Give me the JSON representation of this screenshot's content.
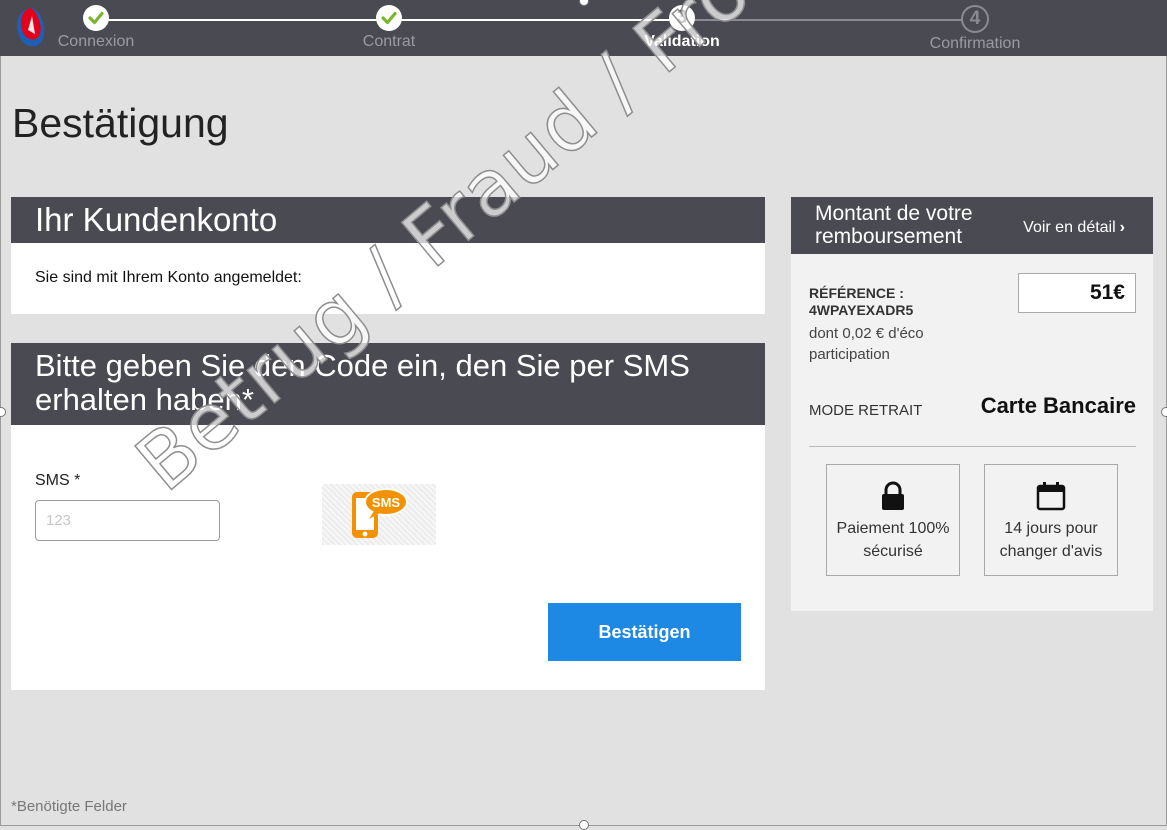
{
  "progress": {
    "steps": [
      {
        "label": "Connexion",
        "state": "done"
      },
      {
        "label": "Contrat",
        "state": "done"
      },
      {
        "label": "Validation",
        "number": "3",
        "state": "active"
      },
      {
        "label": "Confirmation",
        "number": "4",
        "state": "todo"
      }
    ]
  },
  "page": {
    "title": "Bestätigung"
  },
  "account_card": {
    "title": "Ihr Kundenkonto",
    "text": "Sie sind mit Ihrem Konto angemeldet:"
  },
  "sms_card": {
    "title": "Bitte geben Sie den Code ein, den Sie per SMS erhalten haben*",
    "field_label": "SMS *",
    "field_placeholder": "123",
    "field_value": "",
    "submit_label": "Bestätigen"
  },
  "sidebar": {
    "title": "Montant de votre remboursement",
    "detail_link": "Voir en détail",
    "reference_label": "RÉFÉRENCE : 4WPAYEXADR5",
    "reference_note": "dont 0,02 € d'éco participation",
    "amount": "51€",
    "mode_label": "MODE RETRAIT",
    "mode_value": "Carte Bancaire",
    "badges": [
      {
        "icon": "lock-icon",
        "text": "Paiement 100% sécurisé"
      },
      {
        "icon": "calendar-icon",
        "text": "14 jours pour changer d'avis"
      }
    ]
  },
  "footnote": "*Benötigte Felder",
  "watermark": "Betrug / Fraud / Frode / Fraud",
  "colors": {
    "header_bg": "#4a4a52",
    "button_blue": "#1e88e5",
    "check_green": "#7bb52d",
    "sms_orange": "#f39200",
    "page_bg": "#e1e1e1"
  }
}
